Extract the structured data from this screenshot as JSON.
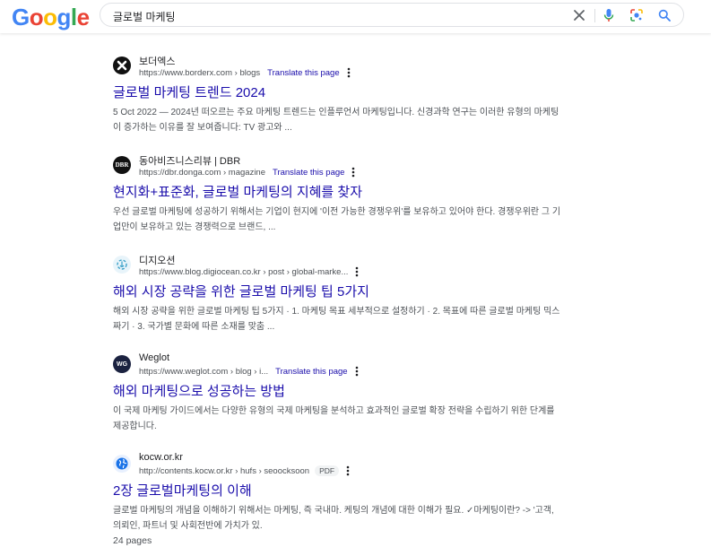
{
  "header": {
    "logo_letters": [
      "G",
      "o",
      "o",
      "g",
      "l",
      "e"
    ],
    "search_query": "글로벌 마케팅",
    "icons": {
      "clear": "close-icon",
      "voice": "microphone-icon",
      "lens": "camera-lens-icon",
      "search": "search-icon"
    }
  },
  "results": [
    {
      "site_name": "보더엑스",
      "url": "https://www.borderx.com › blogs",
      "translate": "Translate this page",
      "title": "글로벌 마케팅 트렌드 2024",
      "snippet": "5 Oct 2022 — 2024년 떠오르는 주요 마케팅 트렌드는 인플루언서 마케팅입니다. 신경과학 연구는 이러한 유형의 마케팅이 증가하는 이유를 잘 보여줍니다: TV 광고와 ...",
      "favicon": "borderx-logo"
    },
    {
      "site_name": "동아비즈니스리뷰 | DBR",
      "url": "https://dbr.donga.com › magazine",
      "translate": "Translate this page",
      "title": "현지화+표준화, 글로벌 마케팅의 지혜를 찾자",
      "snippet": "우선 글로벌 마케팅에 성공하기 위해서는 기업이 현지에 '이전 가능한 경쟁우위'를 보유하고 있어야 한다. 경쟁우위란 그 기업만이 보유하고 있는 경쟁력으로 브랜드, ...",
      "favicon_text": "DBR"
    },
    {
      "site_name": "디지오션",
      "url": "https://www.blog.digiocean.co.kr › post › global-marke...",
      "title": "해외 시장 공략을 위한 글로벌 마케팅 팁 5가지",
      "snippet": "해외 시장 공략을 위한 글로벌 마케팅 팁 5가지 · 1. 마케팅 목표 세부적으로 설정하기 · 2. 목표에 따른 글로벌 마케팅 믹스짜기 · 3. 국가별 문화에 따른 소재를 맞춤 ...",
      "favicon": "digiocean-logo"
    },
    {
      "site_name": "Weglot",
      "url": "https://www.weglot.com › blog › i...",
      "translate": "Translate this page",
      "title": "해외 마케팅으로 성공하는 방법",
      "snippet": "이 국제 마케팅 가이드에서는 다양한 유형의 국제 마케팅을 분석하고 효과적인 글로벌 확장 전략을 수립하기 위한 단계를 제공합니다.",
      "favicon_text": "WG"
    },
    {
      "site_name": "kocw.or.kr",
      "url": "http://contents.kocw.or.kr › hufs › seoocksoon",
      "badge": "PDF",
      "title": "2장 글로벌마케팅의 이해",
      "snippet": "글로벌 마케팅의 개념을 이해하기 위해서는 마케팅, 즉 국내마. 케팅의 개념에 대한 이해가 필요. ✓마케팅이란? -> '고객, 의뢰인, 파트너 및 사회전반에 가치가 있.",
      "extra": "24 pages",
      "favicon": "globe-icon"
    }
  ]
}
